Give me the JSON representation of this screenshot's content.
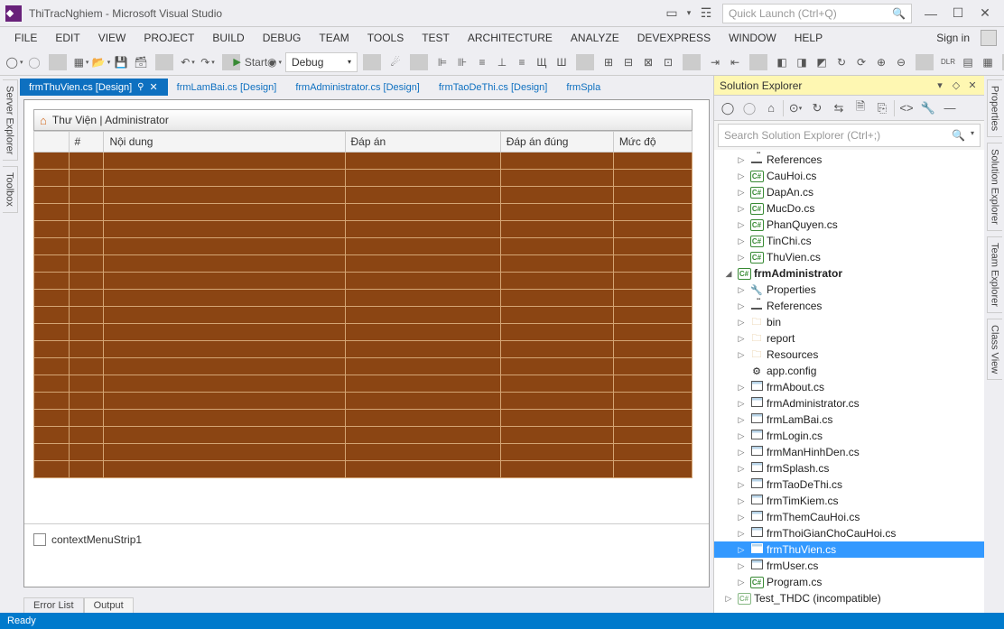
{
  "titlebar": {
    "title": "ThiTracNghiem - Microsoft Visual Studio",
    "quicklaunch_placeholder": "Quick Launch (Ctrl+Q)"
  },
  "menu": {
    "items": [
      "FILE",
      "EDIT",
      "VIEW",
      "PROJECT",
      "BUILD",
      "DEBUG",
      "TEAM",
      "TOOLS",
      "TEST",
      "ARCHITECTURE",
      "ANALYZE",
      "DEVEXPRESS",
      "WINDOW",
      "HELP"
    ],
    "signin": "Sign in"
  },
  "toolbar": {
    "start_label": "Start",
    "config": "Debug"
  },
  "left_tabs": [
    "Server Explorer",
    "Toolbox"
  ],
  "right_tabs": [
    "Properties",
    "Solution Explorer",
    "Team Explorer",
    "Class View"
  ],
  "doc_tabs": [
    {
      "label": "frmThuVien.cs [Design]",
      "active": true
    },
    {
      "label": "frmLamBai.cs [Design]",
      "active": false
    },
    {
      "label": "frmAdministrator.cs [Design]",
      "active": false
    },
    {
      "label": "frmTaoDeThi.cs [Design]",
      "active": false
    },
    {
      "label": "frmSpla",
      "active": false
    }
  ],
  "form": {
    "title": "Thư Viện | Administrator",
    "columns": [
      "#",
      "Nội dung",
      "Đáp án",
      "Đáp án đúng",
      "Mức độ"
    ],
    "row_count": 19
  },
  "tray": {
    "item": "contextMenuStrip1"
  },
  "bottom_tabs": [
    "Error List",
    "Output"
  ],
  "solution": {
    "title": "Solution Explorer",
    "search_placeholder": "Search Solution Explorer (Ctrl+;)",
    "nodes": [
      {
        "ind": 1,
        "exp": "▷",
        "icon": "ref",
        "label": "References"
      },
      {
        "ind": 1,
        "exp": "▷",
        "icon": "cs",
        "label": "CauHoi.cs"
      },
      {
        "ind": 1,
        "exp": "▷",
        "icon": "cs",
        "label": "DapAn.cs"
      },
      {
        "ind": 1,
        "exp": "▷",
        "icon": "cs",
        "label": "MucDo.cs"
      },
      {
        "ind": 1,
        "exp": "▷",
        "icon": "cs",
        "label": "PhanQuyen.cs"
      },
      {
        "ind": 1,
        "exp": "▷",
        "icon": "cs",
        "label": "TinChi.cs"
      },
      {
        "ind": 1,
        "exp": "▷",
        "icon": "cs",
        "label": "ThuVien.cs"
      },
      {
        "ind": 0,
        "exp": "◢",
        "icon": "csproj",
        "label": "frmAdministrator",
        "bold": true
      },
      {
        "ind": 1,
        "exp": "▷",
        "icon": "wrench",
        "label": "Properties"
      },
      {
        "ind": 1,
        "exp": "▷",
        "icon": "ref",
        "label": "References"
      },
      {
        "ind": 1,
        "exp": "▷",
        "icon": "folder",
        "label": "bin"
      },
      {
        "ind": 1,
        "exp": "▷",
        "icon": "folder",
        "label": "report"
      },
      {
        "ind": 1,
        "exp": "▷",
        "icon": "folder",
        "label": "Resources"
      },
      {
        "ind": 1,
        "exp": "",
        "icon": "config",
        "label": "app.config"
      },
      {
        "ind": 1,
        "exp": "▷",
        "icon": "form",
        "label": "frmAbout.cs"
      },
      {
        "ind": 1,
        "exp": "▷",
        "icon": "form",
        "label": "frmAdministrator.cs"
      },
      {
        "ind": 1,
        "exp": "▷",
        "icon": "form",
        "label": "frmLamBai.cs"
      },
      {
        "ind": 1,
        "exp": "▷",
        "icon": "form",
        "label": "frmLogin.cs"
      },
      {
        "ind": 1,
        "exp": "▷",
        "icon": "form",
        "label": "frmManHinhDen.cs"
      },
      {
        "ind": 1,
        "exp": "▷",
        "icon": "form",
        "label": "frmSplash.cs"
      },
      {
        "ind": 1,
        "exp": "▷",
        "icon": "form",
        "label": "frmTaoDeThi.cs"
      },
      {
        "ind": 1,
        "exp": "▷",
        "icon": "form",
        "label": "frmTimKiem.cs"
      },
      {
        "ind": 1,
        "exp": "▷",
        "icon": "form",
        "label": "frmThemCauHoi.cs"
      },
      {
        "ind": 1,
        "exp": "▷",
        "icon": "form",
        "label": "frmThoiGianChoCauHoi.cs"
      },
      {
        "ind": 1,
        "exp": "▷",
        "icon": "form",
        "label": "frmThuVien.cs",
        "selected": true
      },
      {
        "ind": 1,
        "exp": "▷",
        "icon": "form",
        "label": "frmUser.cs"
      },
      {
        "ind": 1,
        "exp": "▷",
        "icon": "cs",
        "label": "Program.cs"
      },
      {
        "ind": 0,
        "exp": "▷",
        "icon": "csproj-dis",
        "label": "Test_THDC (incompatible)"
      }
    ]
  },
  "statusbar": {
    "text": "Ready"
  }
}
